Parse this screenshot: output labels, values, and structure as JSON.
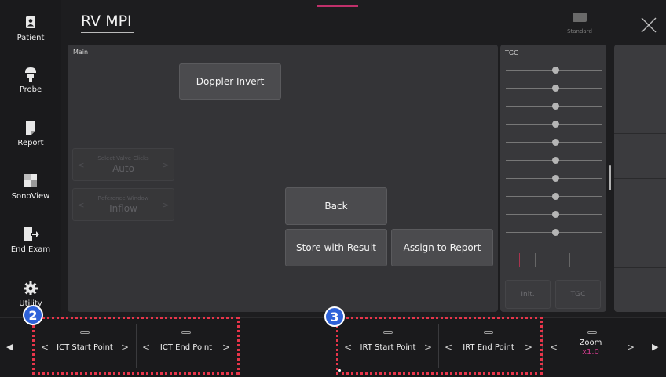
{
  "header": {
    "title": "RV MPI",
    "preset_label": "Standard"
  },
  "sidebar": {
    "items": [
      {
        "label": "Patient",
        "icon": "patient-icon"
      },
      {
        "label": "Probe",
        "icon": "probe-icon"
      },
      {
        "label": "Report",
        "icon": "report-icon"
      },
      {
        "label": "SonoView",
        "icon": "sonoview-icon"
      },
      {
        "label": "End Exam",
        "icon": "end-exam-icon"
      },
      {
        "label": "Utility",
        "icon": "gear-icon"
      }
    ]
  },
  "main": {
    "label": "Main",
    "doppler_invert": "Doppler Invert",
    "select_valve_clicks": {
      "title": "Select Valve Clicks",
      "value": "Auto"
    },
    "reference_window": {
      "title": "Reference Window",
      "value": "Inflow"
    },
    "back": "Back",
    "store_with_result": "Store with Result",
    "assign_to_report": "Assign to Report"
  },
  "tgc": {
    "label": "TGC",
    "slider_count": 10,
    "init_button": "Init.",
    "tgc_button": "TGC"
  },
  "bottom": {
    "ict_start": "ICT Start Point",
    "ict_end": "ICT End Point",
    "irt_start": "IRT Start Point",
    "irt_end": "IRT End Point",
    "zoom_label": "Zoom",
    "zoom_value": "x1.0"
  },
  "annotations": {
    "badge_2": "2",
    "badge_3": "3"
  },
  "colors": {
    "accent_pink": "#d23a8e",
    "annotation_red": "#e8354a",
    "badge_blue": "#2e62d9"
  }
}
